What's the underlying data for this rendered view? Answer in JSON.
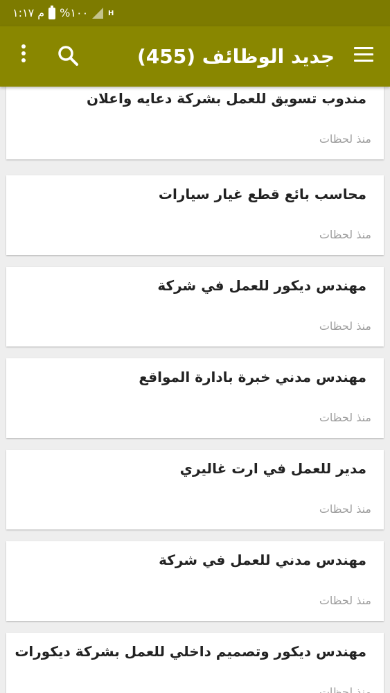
{
  "status_bar": {
    "time": "م ١:١٧",
    "battery_text": "%١٠٠",
    "network_type": "H",
    "icons": [
      "battery-icon",
      "signal-icon"
    ]
  },
  "app_bar": {
    "title": "جديد الوظائف (455)",
    "icons": [
      "menu-icon",
      "search-icon",
      "more-vert-icon"
    ]
  },
  "jobs": [
    {
      "title": "مندوب تسويق للعمل بشركة دعايه واعلان",
      "time": "منذ لحظات"
    },
    {
      "title": "محاسب بائع قطع غيار سيارات",
      "time": "منذ لحظات"
    },
    {
      "title": "مهندس ديكور للعمل في شركة",
      "time": "منذ لحظات"
    },
    {
      "title": "مهندس مدني خبرة بادارة المواقع",
      "time": "منذ لحظات"
    },
    {
      "title": "مدير للعمل في ارت غاليري",
      "time": "منذ لحظات"
    },
    {
      "title": "مهندس مدني للعمل في شركة",
      "time": "منذ لحظات"
    },
    {
      "title": "مهندس ديكور وتصميم داخلي للعمل بشركة ديكورات",
      "time": "منذ لحظات"
    }
  ],
  "colors": {
    "status_bar": "#7d7b00",
    "app_bar": "#898700",
    "background": "#eeeeee",
    "card": "#ffffff",
    "title_text": "#222222",
    "time_text": "#9e9e9e"
  }
}
